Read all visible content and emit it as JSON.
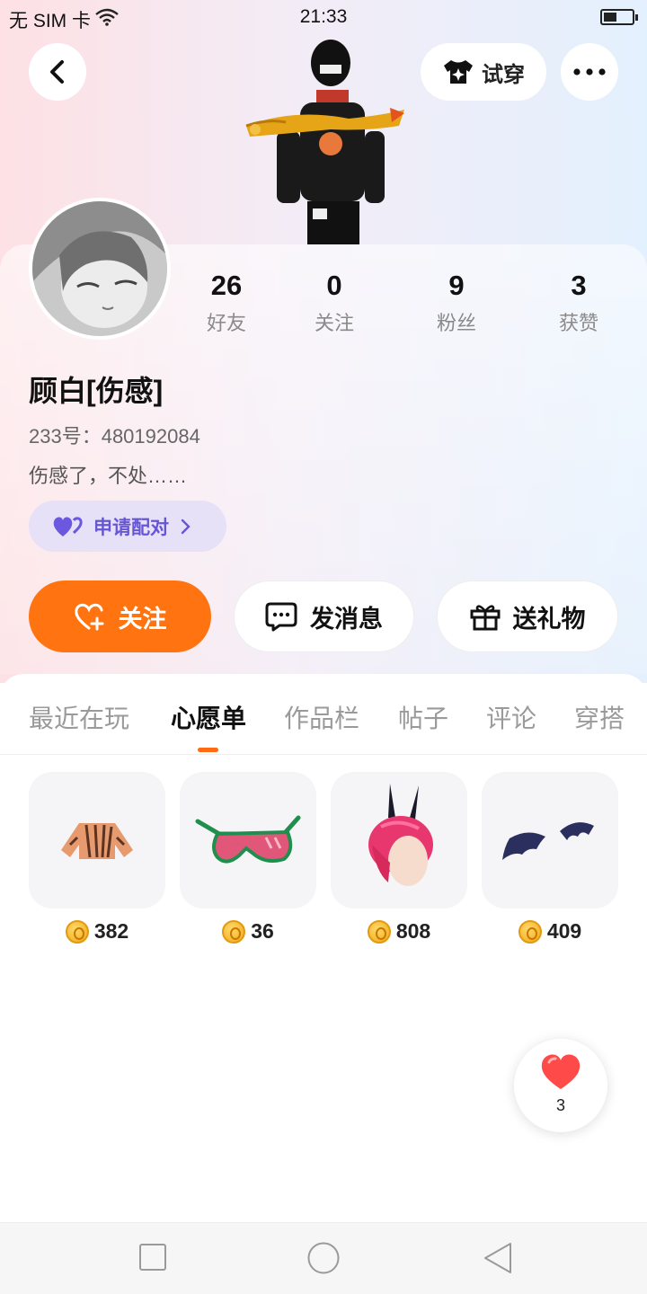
{
  "status_bar": {
    "carrier": "无 SIM 卡",
    "time": "21:33"
  },
  "header": {
    "back_icon": "chevron-left-icon",
    "tryon_label": "试穿",
    "tryon_icon": "tshirt-sparkle-icon",
    "more_icon": "more-dots-icon"
  },
  "profile": {
    "stats": [
      {
        "value": "26",
        "label": "好友"
      },
      {
        "value": "0",
        "label": "关注"
      },
      {
        "value": "9",
        "label": "粉丝"
      },
      {
        "value": "3",
        "label": "获赞"
      }
    ],
    "name": "顾白[伤感]",
    "uid": "233号：480192084",
    "bio": "伤感了，不处……",
    "pair_label": "申请配对"
  },
  "actions": {
    "follow_label": "关注",
    "message_label": "发消息",
    "gift_label": "送礼物"
  },
  "tabs": [
    {
      "label": "最近在玩",
      "active": false
    },
    {
      "label": "心愿单",
      "active": true
    },
    {
      "label": "作品栏",
      "active": false
    },
    {
      "label": "帖子",
      "active": false
    },
    {
      "label": "评论",
      "active": false
    },
    {
      "label": "穿搭",
      "active": false
    }
  ],
  "wishlist": [
    {
      "name": "tiger-stripe-jacket-icon",
      "price": "382"
    },
    {
      "name": "pink-sunglasses-icon",
      "price": "36"
    },
    {
      "name": "horned-pink-hair-icon",
      "price": "808"
    },
    {
      "name": "bat-wings-icon",
      "price": "409"
    }
  ],
  "like_float": {
    "count": "3",
    "icon": "heart-icon"
  },
  "colors": {
    "accent_orange": "#ff7410",
    "pair_purple": "#6656d6",
    "pair_bg": "#e6e1f7"
  }
}
